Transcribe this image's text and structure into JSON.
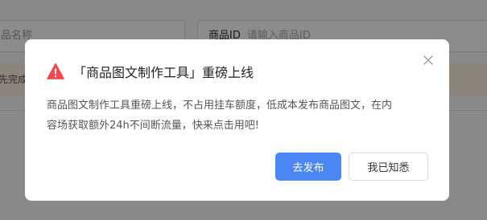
{
  "background": {
    "left_input_text": "品名称",
    "right_input_label": "商品ID",
    "right_input_placeholder": "请输入商品ID",
    "banner_text": "先完成"
  },
  "dialog": {
    "title": "「商品图文制作工具」重磅上线",
    "body": "商品图文制作工具重磅上线，不占用挂车额度，低成本发布商品图文，在内容场获取额外24h不间断流量，快来点击用吧!",
    "primary_button": "去发布",
    "secondary_button": "我已知悉"
  },
  "icons": {
    "title_icon": "warning-triangle-icon",
    "close_icon": "close-icon"
  },
  "colors": {
    "warning": "#f0484f",
    "primary": "#4a87f5",
    "banner": "#fdf3e6"
  }
}
